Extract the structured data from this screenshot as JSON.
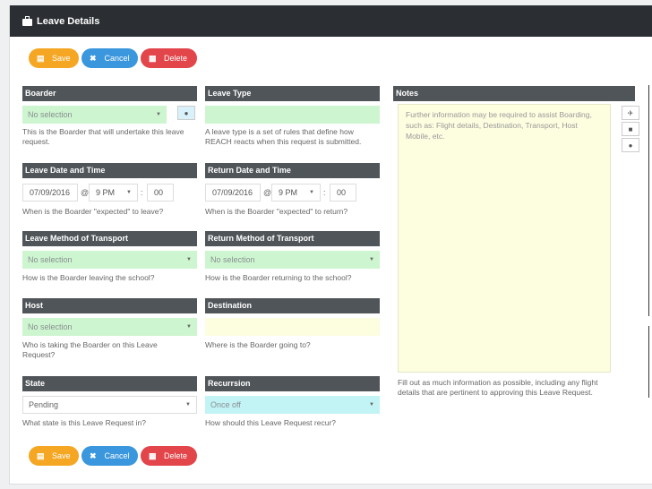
{
  "header": {
    "title": "Leave Details",
    "icon": "briefcase-icon"
  },
  "buttons": {
    "save": "Save",
    "cancel": "Cancel",
    "delete": "Delete"
  },
  "boarder": {
    "label": "Boarder",
    "value": "No selection",
    "help": "This is the Boarder that will undertake this leave request."
  },
  "leave_type": {
    "label": "Leave Type",
    "value": "",
    "help": "A leave type is a set of rules that define how REACH reacts when this request is submitted."
  },
  "notes": {
    "label": "Notes",
    "placeholder": "Further information may be required to assist Boarding, such as: Flight details, Destination, Transport, Host Mobile, etc.",
    "help": "Fill out as much information as possible, including any flight details that are pertinent to approving this Leave Request."
  },
  "leave_date": {
    "label": "Leave Date and Time",
    "date": "07/09/2016",
    "at": "@",
    "hour": "9 PM",
    "sep": ":",
    "minute": "00",
    "help": "When is the Boarder \"expected\" to leave?"
  },
  "return_date": {
    "label": "Return Date and Time",
    "date": "07/09/2016",
    "at": "@",
    "hour": "9 PM",
    "sep": ":",
    "minute": "00",
    "help": "When is the Boarder \"expected\" to return?"
  },
  "leave_transport": {
    "label": "Leave Method of Transport",
    "value": "No selection",
    "help": "How is the Boarder leaving the school?"
  },
  "return_transport": {
    "label": "Return Method of Transport",
    "value": "No selection",
    "help": "How is the Boarder returning to the school?"
  },
  "host": {
    "label": "Host",
    "value": "No selection",
    "help": "Who is taking the Boarder on this Leave Request?"
  },
  "destination": {
    "label": "Destination",
    "value": "",
    "help": "Where is the Boarder going to?"
  },
  "state": {
    "label": "State",
    "value": "Pending",
    "help": "What state is this Leave Request in?"
  },
  "recursion": {
    "label": "Recurrsion",
    "value": "Once off",
    "help": "How should this Leave Request recur?"
  },
  "colors": {
    "save": "#f5a623",
    "cancel": "#3a96dd",
    "delete": "#e2454a",
    "header": "#2b2f33",
    "section": "#505559"
  }
}
